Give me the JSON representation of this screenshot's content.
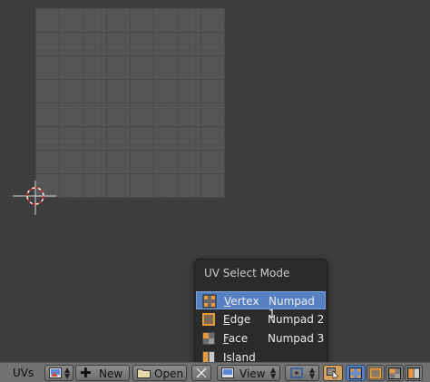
{
  "header": {
    "menu_label": "UVs",
    "new_label": "New",
    "open_label": "Open",
    "view_label": "View"
  },
  "menu": {
    "title": "UV Select Mode",
    "items": [
      {
        "label_first": "V",
        "label_rest": "ertex",
        "shortcut": "Numpad 1",
        "icon": "vertex-mode-icon",
        "active": true
      },
      {
        "label_first": "E",
        "label_rest": "dge",
        "shortcut": "Numpad 2",
        "icon": "edge-mode-icon",
        "active": false
      },
      {
        "label_first": "F",
        "label_rest": "ace",
        "shortcut": "Numpad 3",
        "icon": "face-mode-icon",
        "active": false
      },
      {
        "label_first": "I",
        "label_rest": "sland",
        "shortcut": "",
        "icon": "island-mode-icon",
        "active": false
      }
    ]
  },
  "colors": {
    "background": "#3d3d3d",
    "grid": "#565656",
    "header": "#727272",
    "menu_bg": "#2b2b2b",
    "highlight": "#5680c2",
    "icon_orange": "#e69a3c"
  }
}
